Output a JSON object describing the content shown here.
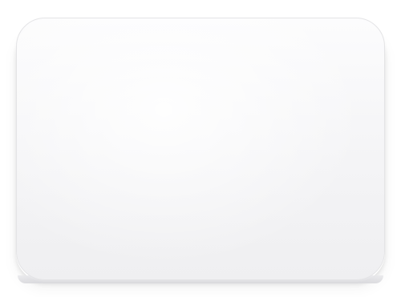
{
  "image": {
    "subject": "",
    "colors": {
      "background": "#ffffff",
      "surface": "#f5f5f7",
      "edge": "#dcdce0"
    }
  }
}
